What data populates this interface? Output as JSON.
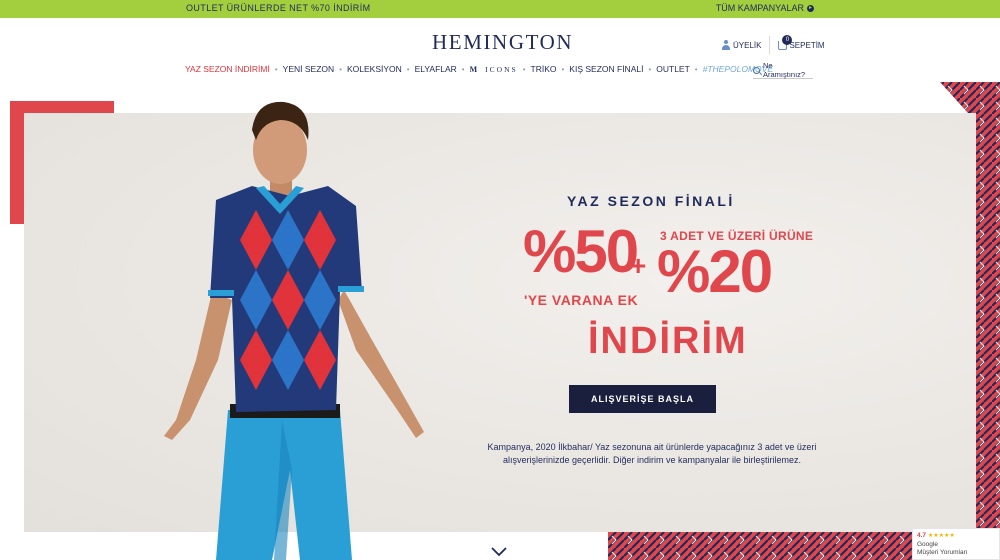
{
  "topbar": {
    "promo": "OUTLET ÜRÜNLERDE NET %70 İNDİRİM",
    "campaigns": "TÜM KAMPANYALAR"
  },
  "header": {
    "logo": "HEMINGTON",
    "membership": "ÜYELİK",
    "cart_label": "SEPETİM",
    "cart_count": "0"
  },
  "nav": {
    "items": [
      "YAZ SEZON İNDİRİMİ",
      "YENİ SEZON",
      "KOLEKSİYON",
      "ELYAFLAR",
      "ICONS",
      "TRİKO",
      "KIŞ SEZON FİNALİ",
      "OUTLET",
      "#THEPOLOMOVE"
    ],
    "icons_mark": "M",
    "search_placeholder": "Ne Aramıştınız?"
  },
  "hero": {
    "season_title": "YAZ SEZON FİNALİ",
    "discount_main": "%50",
    "discount_main_suffix": "'YE VARANA EK",
    "plus": "+",
    "bundle_note": "3 ADET VE ÜZERİ ÜRÜNE",
    "discount_extra": "%20",
    "discount_word": "İNDİRİM",
    "cta_label": "ALIŞVERİŞE BAŞLA",
    "description": "Kampanya, 2020 İlkbahar/ Yaz sezonuna ait ürünlerde yapacağınız 3 adet ve üzeri alışverişlerinizde geçerlidir. Diğer indirim ve kampanyalar ile birleştirilemez."
  },
  "rating_widget": {
    "score": "4.7",
    "stars": "★★★★★",
    "source": "Google",
    "label": "Müşteri Yorumları"
  },
  "colors": {
    "topbar": "#a3cf3f",
    "navy": "#1f2a5a",
    "accent_red": "#e0474c",
    "cta_bg": "#1a1f3d",
    "hero_bg": "#ebe7e2"
  }
}
